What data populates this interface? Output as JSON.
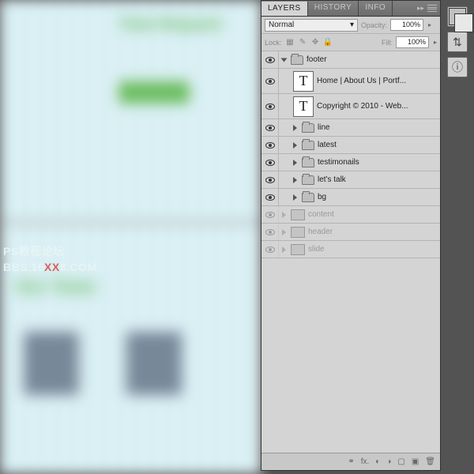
{
  "watermark": {
    "line1": "PS教程论坛",
    "line2_pre": "BBS.16",
    "line2_xx": "XX",
    "line2_post": "8.COM"
  },
  "tabs": {
    "layers": "LAYERS",
    "history": "HISTORY",
    "info": "INFO"
  },
  "blend": {
    "mode": "Normal",
    "opacity_label": "Opacity:",
    "opacity_value": "100%",
    "lock_label": "Lock:",
    "fill_label": "Fill:",
    "fill_value": "100%"
  },
  "layers": {
    "footer_group": "footer",
    "text1": "Home | About Us | Portf...",
    "text2": "Copyright © 2010 - Web...",
    "sub": [
      "line",
      "latest",
      "testimonails",
      "let's talk",
      "bg"
    ],
    "dim": [
      "content",
      "header",
      "slide"
    ]
  },
  "footer_icons": {
    "link": "⚭",
    "fx": "fx.",
    "mask": "◐",
    "adj": "◑",
    "folder": "▢",
    "new": "▣",
    "trash": "🗑"
  }
}
